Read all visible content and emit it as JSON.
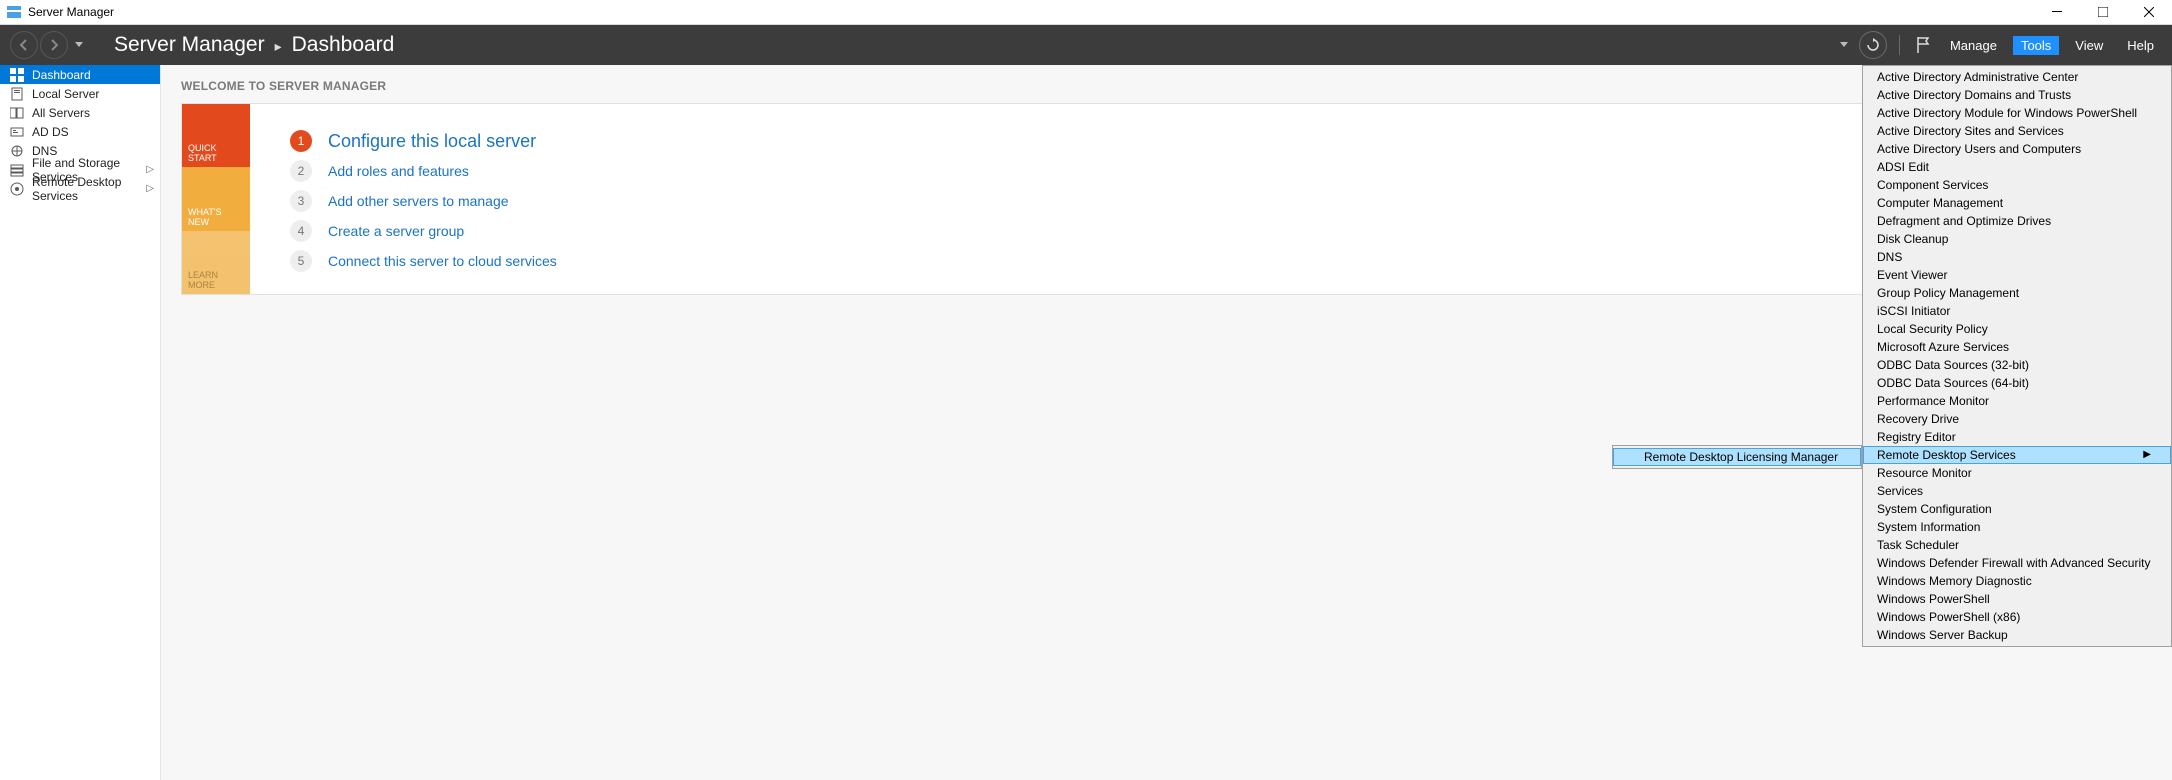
{
  "window": {
    "title": "Server Manager"
  },
  "breadcrumb": {
    "root": "Server Manager",
    "current": "Dashboard"
  },
  "menubar": {
    "manage": "Manage",
    "tools": "Tools",
    "view": "View",
    "help": "Help"
  },
  "sidebar": {
    "items": [
      {
        "label": "Dashboard",
        "icon": "dashboard-icon",
        "active": true
      },
      {
        "label": "Local Server",
        "icon": "server-icon"
      },
      {
        "label": "All Servers",
        "icon": "servers-icon"
      },
      {
        "label": "AD DS",
        "icon": "adds-icon"
      },
      {
        "label": "DNS",
        "icon": "dns-icon"
      },
      {
        "label": "File and Storage Services",
        "icon": "storage-icon",
        "submenu": true
      },
      {
        "label": "Remote Desktop Services",
        "icon": "rds-icon",
        "submenu": true
      }
    ]
  },
  "welcome": {
    "heading": "WELCOME TO SERVER MANAGER",
    "tiles": {
      "quick_start": "QUICK START",
      "whats_new": "WHAT'S NEW",
      "learn_more": "LEARN MORE"
    },
    "steps": [
      "Configure this local server",
      "Add roles and features",
      "Add other servers to manage",
      "Create a server group",
      "Connect this server to cloud services"
    ]
  },
  "tools_menu": {
    "items": [
      "Active Directory Administrative Center",
      "Active Directory Domains and Trusts",
      "Active Directory Module for Windows PowerShell",
      "Active Directory Sites and Services",
      "Active Directory Users and Computers",
      "ADSI Edit",
      "Component Services",
      "Computer Management",
      "Defragment and Optimize Drives",
      "Disk Cleanup",
      "DNS",
      "Event Viewer",
      "Group Policy Management",
      "iSCSI Initiator",
      "Local Security Policy",
      "Microsoft Azure Services",
      "ODBC Data Sources (32-bit)",
      "ODBC Data Sources (64-bit)",
      "Performance Monitor",
      "Recovery Drive",
      "Registry Editor",
      "Remote Desktop Services",
      "Resource Monitor",
      "Services",
      "System Configuration",
      "System Information",
      "Task Scheduler",
      "Windows Defender Firewall with Advanced Security",
      "Windows Memory Diagnostic",
      "Windows PowerShell",
      "Windows PowerShell (x86)",
      "Windows Server Backup"
    ],
    "highlighted_index": 21,
    "submenu": {
      "label": "Remote Desktop Licensing Manager"
    }
  }
}
